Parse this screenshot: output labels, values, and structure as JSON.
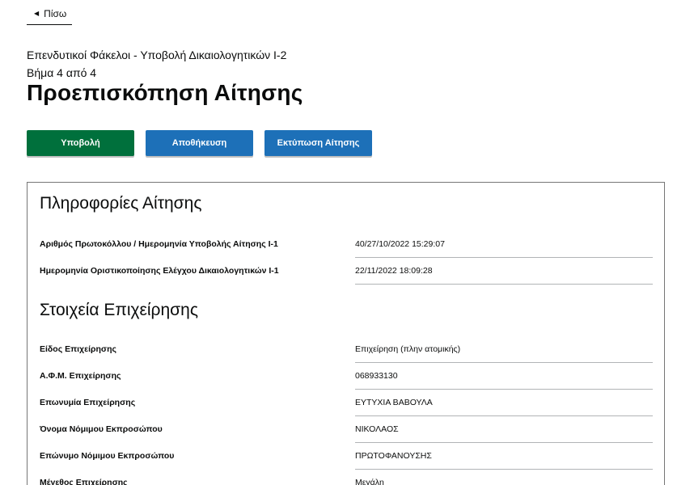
{
  "nav": {
    "back_label": "Πίσω"
  },
  "header": {
    "service_caption": "Επενδυτικοί Φάκελοι - Υποβολή Δικαιολογητικών Ι-2",
    "step_caption": "Βήμα 4 από 4",
    "title": "Προεπισκόπηση Αίτησης"
  },
  "actions": {
    "submit_label": "Υποβολή",
    "save_label": "Αποθήκευση",
    "print_label": "Εκτύπωση Αίτησης"
  },
  "application_info": {
    "heading": "Πληροφορίες Αίτησης",
    "rows": [
      {
        "key": "Αριθμός Πρωτοκόλλου / Ημερομηνία Υποβολής Αίτησης Ι-1",
        "value": "40/27/10/2022 15:29:07"
      },
      {
        "key": "Ημερομηνία Οριστικοποίησης Ελέγχου Δικαιολογητικών Ι-1",
        "value": "22/11/2022 18:09:28"
      }
    ]
  },
  "business_info": {
    "heading": "Στοιχεία Επιχείρησης",
    "rows": [
      {
        "key": "Είδος Επιχείρησης",
        "value": "Επιχείρηση (πλην ατομικής)"
      },
      {
        "key": "Α.Φ.Μ. Επιχείρησης",
        "value": "068933130"
      },
      {
        "key": "Επωνυμία Επιχείρησης",
        "value": "ΕΥΤΥΧΙΑ ΒΑΒΟΥΛΑ"
      },
      {
        "key": "Όνομα Νόμιμου Εκπροσώπου",
        "value": "ΝΙΚΟΛΑΟΣ"
      },
      {
        "key": "Επώνυμο Νόμιμου Εκπροσώπου",
        "value": "ΠΡΩΤΟΦΑΝΟΥΣΗΣ"
      },
      {
        "key": "Μέγεθος Επιχείρησης",
        "value": "Μεγάλη"
      }
    ]
  },
  "colors": {
    "submit_green": "#00703c",
    "action_blue": "#1d70b8",
    "text": "#0b0c0c",
    "divider": "#b1b4b6"
  }
}
